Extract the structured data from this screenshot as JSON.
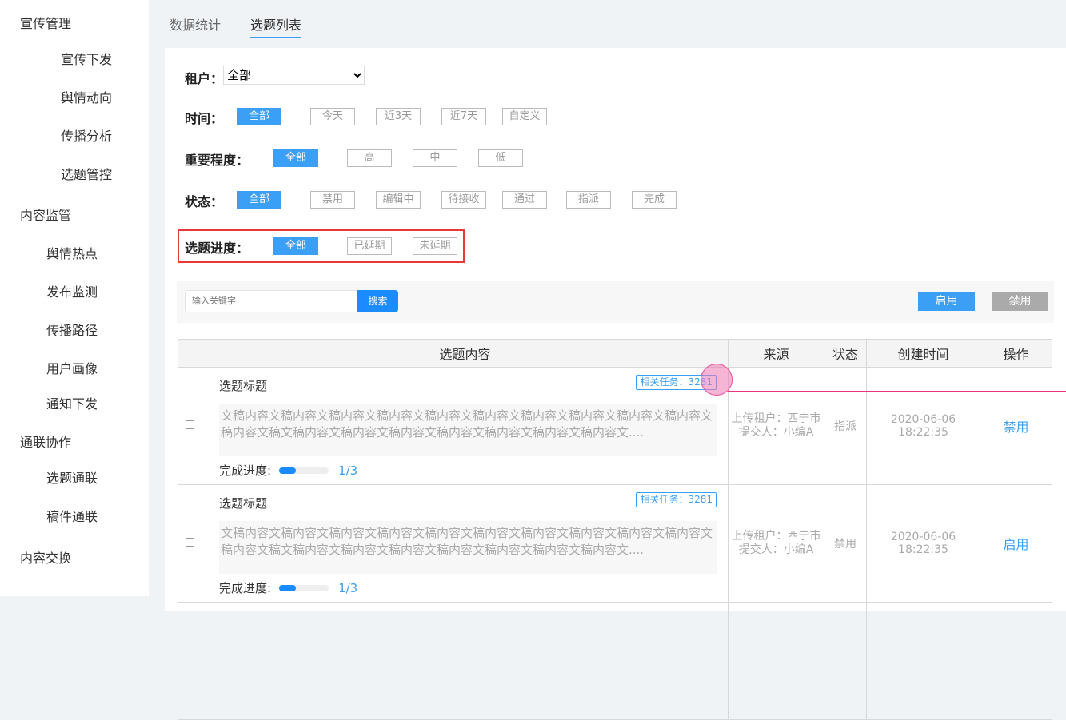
{
  "sidebar": {
    "groups": [
      {
        "label": "宣传管理",
        "items": [
          "宣传下发",
          "舆情动向",
          "传播分析",
          "选题管控"
        ]
      },
      {
        "label": "内容监管",
        "items": [
          "舆情热点",
          "发布监测",
          "传播路径",
          "用户画像",
          "通知下发"
        ]
      },
      {
        "label": "通联协作",
        "items": [
          "选题通联",
          "稿件通联"
        ]
      },
      {
        "label": "内容交换",
        "items": []
      }
    ]
  },
  "tabs": [
    "数据统计",
    "选题列表"
  ],
  "filters": {
    "tenant": {
      "label": "租户：",
      "value": "全部"
    },
    "time": {
      "label": "时间：",
      "options": [
        "全部",
        "今天",
        "近3天",
        "近7天",
        "自定义"
      ]
    },
    "importance": {
      "label": "重要程度：",
      "options": [
        "全部",
        "高",
        "中",
        "低"
      ]
    },
    "status": {
      "label": "状态：",
      "options": [
        "全部",
        "禁用",
        "编辑中",
        "待接收",
        "通过",
        "指派",
        "完成"
      ]
    },
    "progress": {
      "label": "选题进度：",
      "options": [
        "全部",
        "已延期",
        "未延期"
      ]
    }
  },
  "toolbar": {
    "search_placeholder": "输入关键字",
    "search_label": "搜索",
    "enable_label": "启用",
    "disable_label": "禁用"
  },
  "table": {
    "headers": [
      "选题内容",
      "来源",
      "状态",
      "创建时间",
      "操作"
    ],
    "rows": [
      {
        "title": "选题标题",
        "related": "相关任务：3281",
        "content": "文稿内容文稿内容文稿内容文稿内容文稿内容文稿内容文稿内容文稿内容文稿内容文稿内容文稿内容文稿文稿内容文稿内容文稿内容文稿内容文稿内容文稿内容文稿内容文....",
        "progress_label": "完成进度:",
        "progress": "1/3",
        "source1": "上传租户：西宁市",
        "source2": "提交人：小编A",
        "status": "指派",
        "created": "2020-06-06 18:22:35",
        "action": "禁用"
      },
      {
        "title": "选题标题",
        "related": "相关任务：3281",
        "content": "文稿内容文稿内容文稿内容文稿内容文稿内容文稿内容文稿内容文稿内容文稿内容文稿内容文稿内容文稿文稿内容文稿内容文稿内容文稿内容文稿内容文稿内容文稿内容文....",
        "progress_label": "完成进度:",
        "progress": "1/3",
        "source1": "上传租户：西宁市",
        "source2": "提交人：小编A",
        "status": "禁用",
        "created": "2020-06-06 18:22:35",
        "action": "启用"
      }
    ]
  },
  "colors": {
    "accent": "#3a9ff5",
    "highlight": "#e53935"
  }
}
